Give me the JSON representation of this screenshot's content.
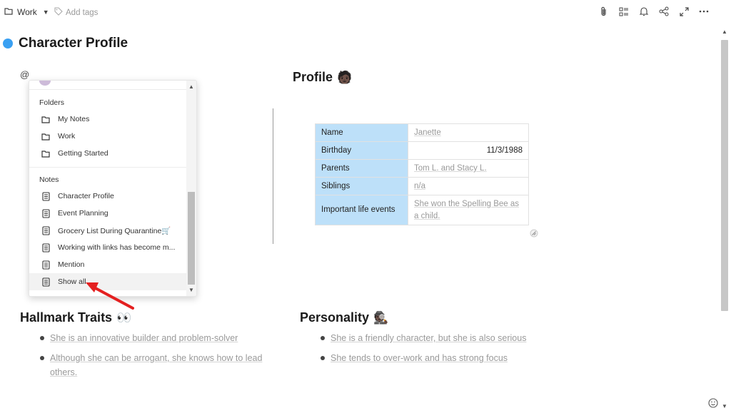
{
  "topbar": {
    "folder": "Work",
    "tags_placeholder": "Add tags",
    "icons": [
      "paperclip-icon",
      "outline-icon",
      "bell-icon",
      "share-icon",
      "expand-icon",
      "more-icon"
    ]
  },
  "page": {
    "title": "Character Profile",
    "title_dot_color": "#3aa0f2",
    "at_symbol": "@"
  },
  "mention_menu": {
    "folders_header": "Folders",
    "folders": [
      "My Notes",
      "Work",
      "Getting Started"
    ],
    "notes_header": "Notes",
    "notes": [
      "Character Profile",
      "Event Planning",
      "Grocery List During Quarantine🛒",
      "Working with links has become m...",
      "Mention",
      "Show all"
    ]
  },
  "profile": {
    "heading": "Profile",
    "heading_emoji": "🧑🏿",
    "rows": [
      {
        "key": "Name",
        "value": "Janette"
      },
      {
        "key": "Birthday",
        "value": "11/3/1988"
      },
      {
        "key": "Parents",
        "value": "Tom L. and Stacy L."
      },
      {
        "key": "Siblings",
        "value": "n/a"
      },
      {
        "key": "Important life events",
        "value": "She won the Spelling Bee as a child."
      }
    ],
    "key_cell_color": "#bde0f9"
  },
  "hallmark": {
    "heading": "Hallmark Traits",
    "heading_emoji": "👀",
    "items": [
      "She is an innovative builder and problem-solver",
      "Although she can be arrogant, she knows how to lead others."
    ]
  },
  "personality": {
    "heading": "Personality",
    "heading_emoji": "🕵🏿",
    "items": [
      "She is a friendly character, but she is also serious",
      "She tends to over-work and has strong focus"
    ]
  }
}
